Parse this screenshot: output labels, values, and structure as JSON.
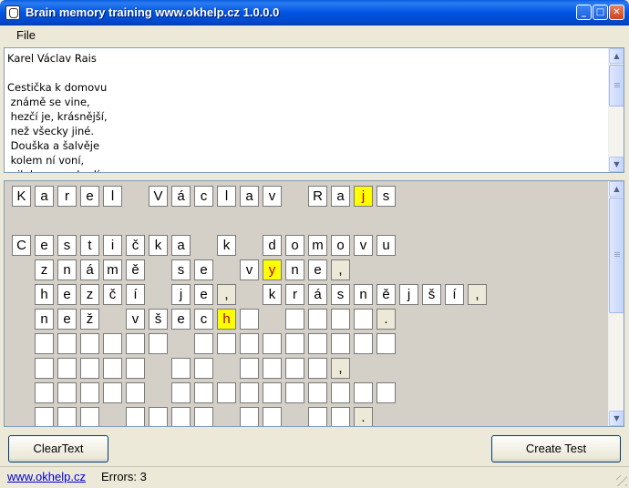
{
  "window": {
    "title": "Brain memory training www.okhelp.cz 1.0.0.0",
    "controls": {
      "minimize": "_",
      "maximize": "□",
      "close": "✕"
    }
  },
  "menu": {
    "file": "File"
  },
  "textarea": {
    "text": "Karel Václav Rais\n\nCestička k domovu\n známě se vine,\n hezčí je, krásnější,\n než všecky jiné.\n Douška a šalvěje\n kolem ní voní,\n nikde se nechodí"
  },
  "grid": {
    "rows": [
      {
        "y": 0,
        "cells": [
          {
            "c": 0,
            "t": "K"
          },
          {
            "c": 1,
            "t": "a"
          },
          {
            "c": 2,
            "t": "r"
          },
          {
            "c": 3,
            "t": "e"
          },
          {
            "c": 4,
            "t": "l"
          },
          {
            "c": 6,
            "t": "V"
          },
          {
            "c": 7,
            "t": "á"
          },
          {
            "c": 8,
            "t": "c"
          },
          {
            "c": 9,
            "t": "l"
          },
          {
            "c": 10,
            "t": "a"
          },
          {
            "c": 11,
            "t": "v"
          },
          {
            "c": 13,
            "t": "R"
          },
          {
            "c": 14,
            "t": "a"
          },
          {
            "c": 15,
            "t": "j",
            "s": "yellow"
          },
          {
            "c": 16,
            "t": "s"
          }
        ]
      },
      {
        "y": 2,
        "cells": [
          {
            "c": 0,
            "t": "C"
          },
          {
            "c": 1,
            "t": "e"
          },
          {
            "c": 2,
            "t": "s"
          },
          {
            "c": 3,
            "t": "t"
          },
          {
            "c": 4,
            "t": "i"
          },
          {
            "c": 5,
            "t": "č"
          },
          {
            "c": 6,
            "t": "k"
          },
          {
            "c": 7,
            "t": "a"
          },
          {
            "c": 9,
            "t": "k"
          },
          {
            "c": 11,
            "t": "d"
          },
          {
            "c": 12,
            "t": "o"
          },
          {
            "c": 13,
            "t": "m"
          },
          {
            "c": 14,
            "t": "o"
          },
          {
            "c": 15,
            "t": "v"
          },
          {
            "c": 16,
            "t": "u"
          }
        ]
      },
      {
        "y": 3,
        "cells": [
          {
            "c": 1,
            "t": "z"
          },
          {
            "c": 2,
            "t": "n"
          },
          {
            "c": 3,
            "t": "á"
          },
          {
            "c": 4,
            "t": "m"
          },
          {
            "c": 5,
            "t": "ě"
          },
          {
            "c": 7,
            "t": "s"
          },
          {
            "c": 8,
            "t": "e"
          },
          {
            "c": 10,
            "t": "v"
          },
          {
            "c": 11,
            "t": "y",
            "s": "yellow"
          },
          {
            "c": 12,
            "t": "n"
          },
          {
            "c": 13,
            "t": "e"
          },
          {
            "c": 14,
            "t": ",",
            "s": "punct"
          }
        ]
      },
      {
        "y": 4,
        "cells": [
          {
            "c": 1,
            "t": "h"
          },
          {
            "c": 2,
            "t": "e"
          },
          {
            "c": 3,
            "t": "z"
          },
          {
            "c": 4,
            "t": "č"
          },
          {
            "c": 5,
            "t": "í"
          },
          {
            "c": 7,
            "t": "j"
          },
          {
            "c": 8,
            "t": "e"
          },
          {
            "c": 9,
            "t": ",",
            "s": "punct"
          },
          {
            "c": 11,
            "t": "k"
          },
          {
            "c": 12,
            "t": "r"
          },
          {
            "c": 13,
            "t": "á"
          },
          {
            "c": 14,
            "t": "s"
          },
          {
            "c": 15,
            "t": "n"
          },
          {
            "c": 16,
            "t": "ě"
          },
          {
            "c": 17,
            "t": "j"
          },
          {
            "c": 18,
            "t": "š"
          },
          {
            "c": 19,
            "t": "í"
          },
          {
            "c": 20,
            "t": ",",
            "s": "punct"
          }
        ]
      },
      {
        "y": 5,
        "cells": [
          {
            "c": 1,
            "t": "n"
          },
          {
            "c": 2,
            "t": "e"
          },
          {
            "c": 3,
            "t": "ž"
          },
          {
            "c": 5,
            "t": "v"
          },
          {
            "c": 6,
            "t": "š"
          },
          {
            "c": 7,
            "t": "e"
          },
          {
            "c": 8,
            "t": "c"
          },
          {
            "c": 9,
            "t": "h",
            "s": "yellow"
          },
          {
            "c": 10,
            "t": ""
          },
          {
            "c": 12,
            "t": ""
          },
          {
            "c": 13,
            "t": ""
          },
          {
            "c": 14,
            "t": ""
          },
          {
            "c": 15,
            "t": ""
          },
          {
            "c": 16,
            "t": ".",
            "s": "punct"
          }
        ]
      },
      {
        "y": 6,
        "cells": [
          {
            "c": 1,
            "t": ""
          },
          {
            "c": 2,
            "t": ""
          },
          {
            "c": 3,
            "t": ""
          },
          {
            "c": 4,
            "t": ""
          },
          {
            "c": 5,
            "t": ""
          },
          {
            "c": 6,
            "t": ""
          },
          {
            "c": 8,
            "t": ""
          },
          {
            "c": 9,
            "t": ""
          },
          {
            "c": 10,
            "t": ""
          },
          {
            "c": 11,
            "t": ""
          },
          {
            "c": 12,
            "t": ""
          },
          {
            "c": 13,
            "t": ""
          },
          {
            "c": 14,
            "t": ""
          },
          {
            "c": 15,
            "t": ""
          },
          {
            "c": 16,
            "t": ""
          }
        ]
      },
      {
        "y": 7,
        "cells": [
          {
            "c": 1,
            "t": ""
          },
          {
            "c": 2,
            "t": ""
          },
          {
            "c": 3,
            "t": ""
          },
          {
            "c": 4,
            "t": ""
          },
          {
            "c": 5,
            "t": ""
          },
          {
            "c": 7,
            "t": ""
          },
          {
            "c": 8,
            "t": ""
          },
          {
            "c": 10,
            "t": ""
          },
          {
            "c": 11,
            "t": ""
          },
          {
            "c": 12,
            "t": ""
          },
          {
            "c": 13,
            "t": ""
          },
          {
            "c": 14,
            "t": ",",
            "s": "punct"
          }
        ]
      },
      {
        "y": 8,
        "cells": [
          {
            "c": 1,
            "t": ""
          },
          {
            "c": 2,
            "t": ""
          },
          {
            "c": 3,
            "t": ""
          },
          {
            "c": 4,
            "t": ""
          },
          {
            "c": 5,
            "t": ""
          },
          {
            "c": 7,
            "t": ""
          },
          {
            "c": 8,
            "t": ""
          },
          {
            "c": 9,
            "t": ""
          },
          {
            "c": 10,
            "t": ""
          },
          {
            "c": 11,
            "t": ""
          },
          {
            "c": 12,
            "t": ""
          },
          {
            "c": 13,
            "t": ""
          },
          {
            "c": 14,
            "t": ""
          },
          {
            "c": 15,
            "t": ""
          },
          {
            "c": 16,
            "t": ""
          }
        ]
      },
      {
        "y": 9,
        "cells": [
          {
            "c": 1,
            "t": ""
          },
          {
            "c": 2,
            "t": ""
          },
          {
            "c": 3,
            "t": ""
          },
          {
            "c": 5,
            "t": ""
          },
          {
            "c": 6,
            "t": ""
          },
          {
            "c": 7,
            "t": ""
          },
          {
            "c": 8,
            "t": ""
          },
          {
            "c": 10,
            "t": ""
          },
          {
            "c": 11,
            "t": ""
          },
          {
            "c": 13,
            "t": ""
          },
          {
            "c": 14,
            "t": ""
          },
          {
            "c": 15,
            "t": ".",
            "s": "punct"
          }
        ]
      }
    ]
  },
  "buttons": {
    "clear": "ClearText",
    "create": "Create Test"
  },
  "status": {
    "link": "www.okhelp.cz",
    "errors": "Errors: 3"
  },
  "scroll": {
    "up": "▲",
    "down": "▼"
  },
  "colors": {
    "titlebar": "#0054e3",
    "highlight": "#ffff00",
    "highlight_text": "#b00000",
    "link": "#0000cc"
  }
}
